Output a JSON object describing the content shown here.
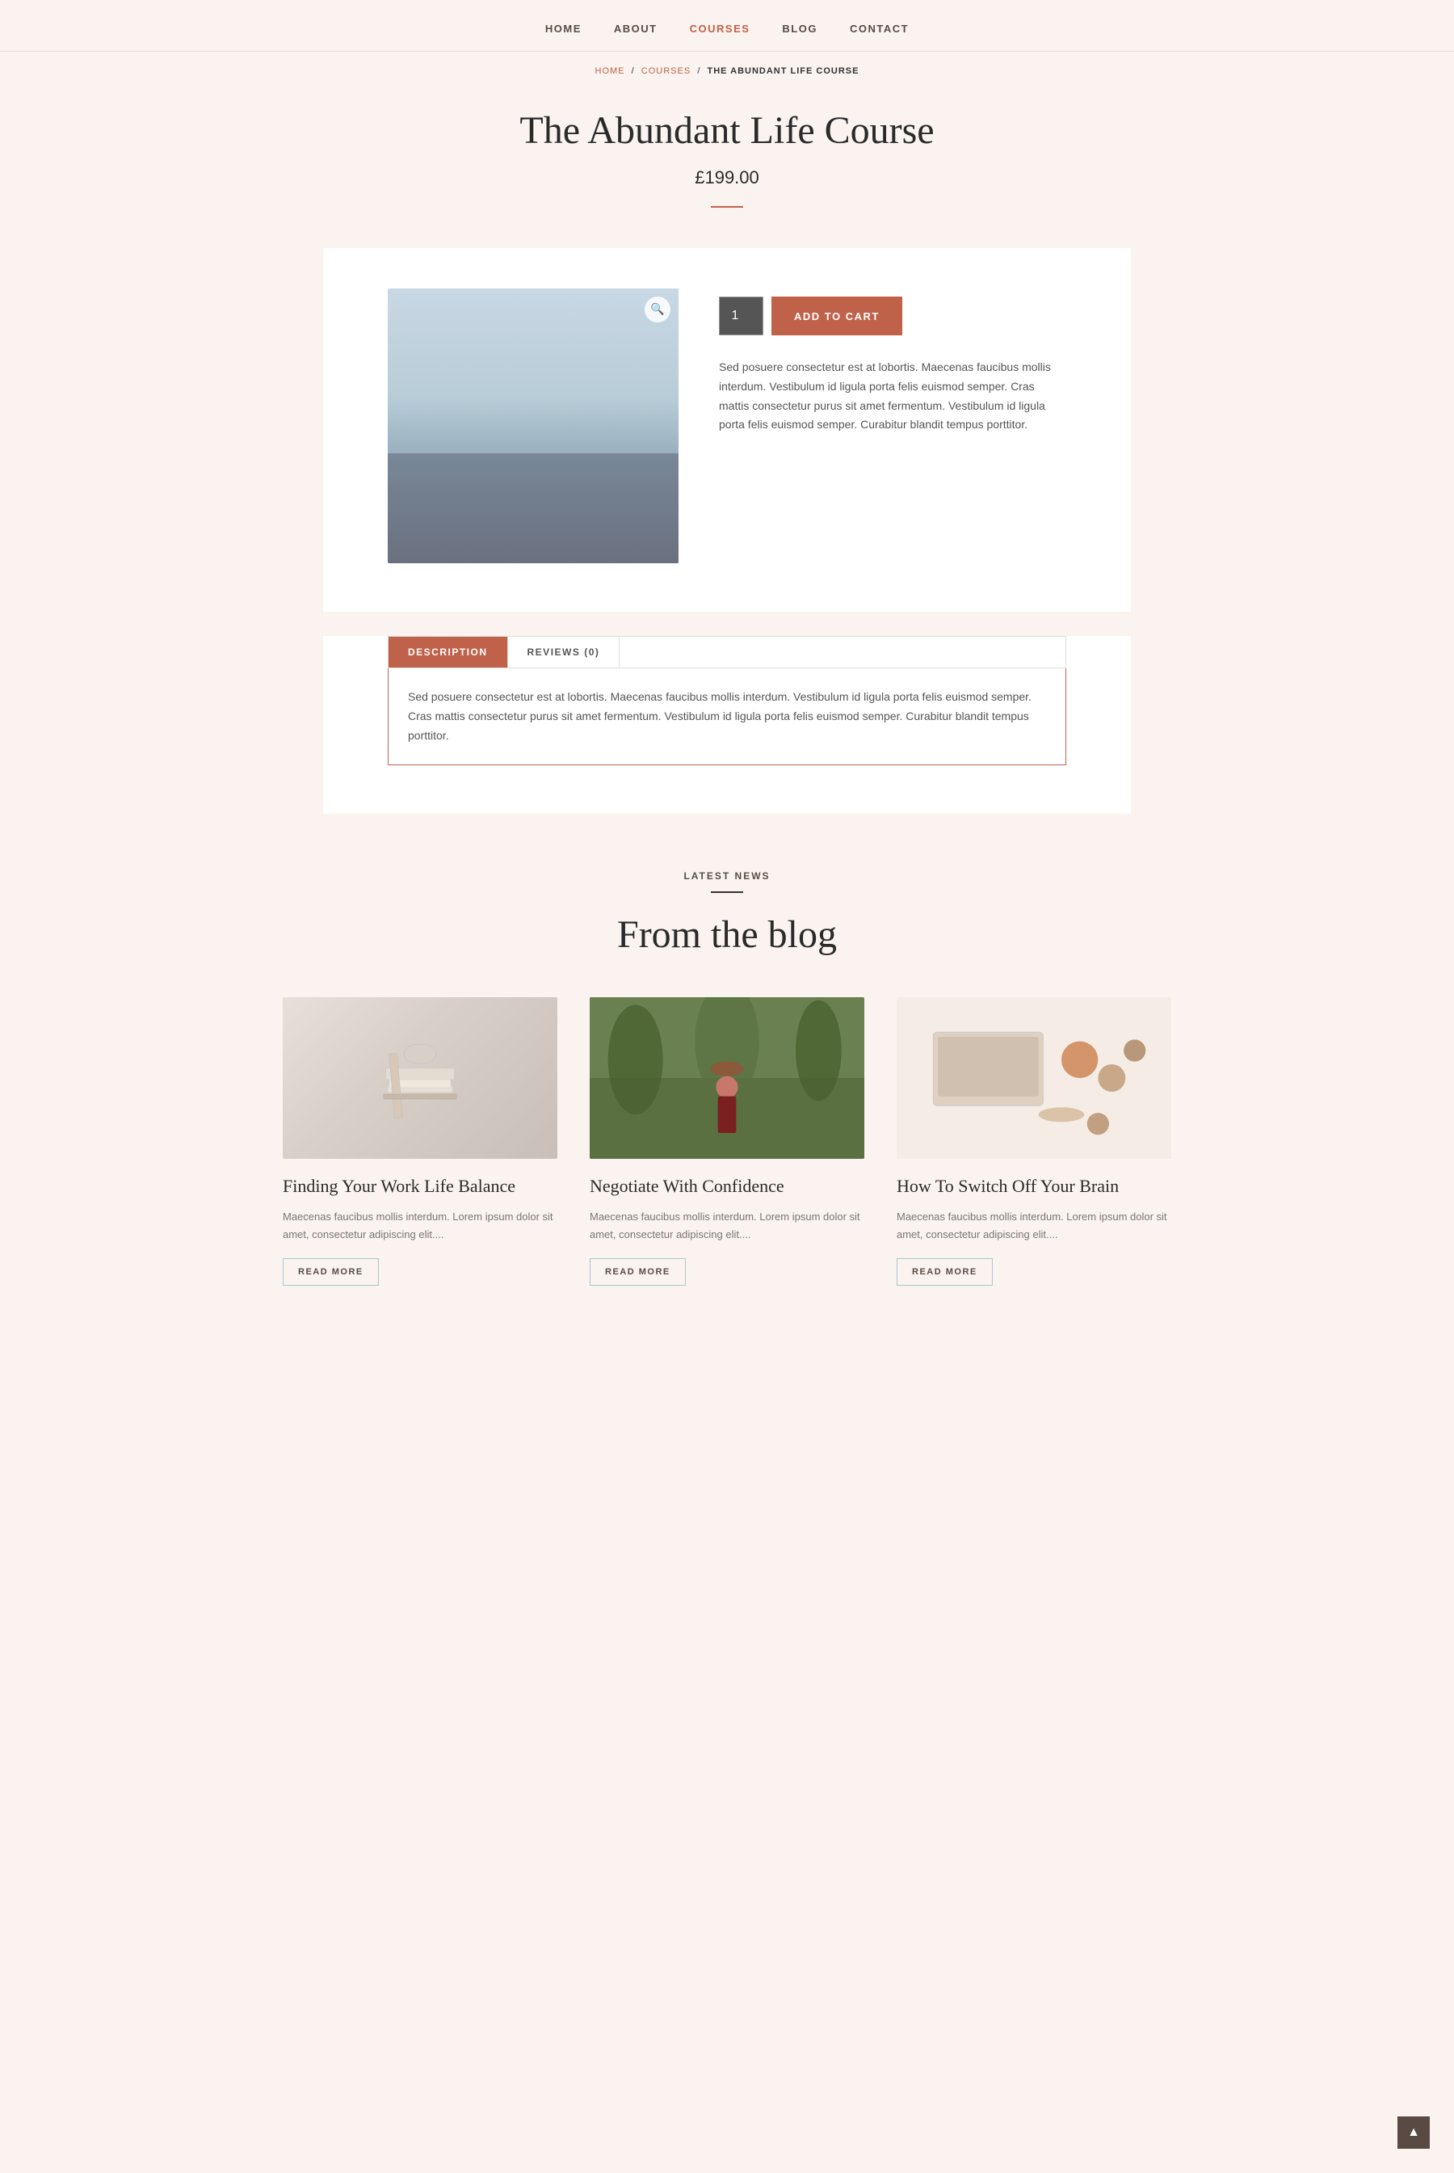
{
  "nav": {
    "links": [
      {
        "label": "HOME",
        "active": false
      },
      {
        "label": "ABOUT",
        "active": false
      },
      {
        "label": "COURSES",
        "active": true
      },
      {
        "label": "BLOG",
        "active": false
      },
      {
        "label": "CONTACT",
        "active": false
      }
    ]
  },
  "breadcrumb": {
    "home": "HOME",
    "courses": "COURSES",
    "current": "THE ABUNDANT LIFE COURSE"
  },
  "product": {
    "title": "The Abundant Life Course",
    "price": "£199.00",
    "qty": "1",
    "add_to_cart": "ADD TO CART",
    "description": "Sed posuere consectetur est at lobortis. Maecenas faucibus mollis interdum. Vestibulum id ligula porta felis euismod semper. Cras mattis consectetur purus sit amet fermentum. Vestibulum id ligula porta felis euismod semper. Curabitur blandit tempus porttitor."
  },
  "tabs": {
    "tab1_label": "DESCRIPTION",
    "tab2_label": "REVIEWS (0)",
    "description_content": "Sed posuere consectetur est at lobortis. Maecenas faucibus mollis interdum. Vestibulum id ligula porta felis euismod semper. Cras mattis consectetur purus sit amet fermentum. Vestibulum id ligula porta felis euismod semper. Curabitur blandit tempus porttitor."
  },
  "blog": {
    "section_label": "LATEST NEWS",
    "heading": "From the blog",
    "posts": [
      {
        "title": "Finding Your Work Life Balance",
        "excerpt": "Maecenas faucibus mollis interdum. Lorem ipsum dolor sit amet, consectetur adipiscing elit....",
        "read_more": "READ MORE"
      },
      {
        "title": "Negotiate With Confidence",
        "excerpt": "Maecenas faucibus mollis interdum. Lorem ipsum dolor sit amet, consectetur adipiscing elit....",
        "read_more": "READ MORE"
      },
      {
        "title": "How To Switch Off Your Brain",
        "excerpt": "Maecenas faucibus mollis interdum. Lorem ipsum dolor sit amet, consectetur adipiscing elit....",
        "read_more": "READ MORE"
      }
    ]
  },
  "back_to_top": "▲"
}
